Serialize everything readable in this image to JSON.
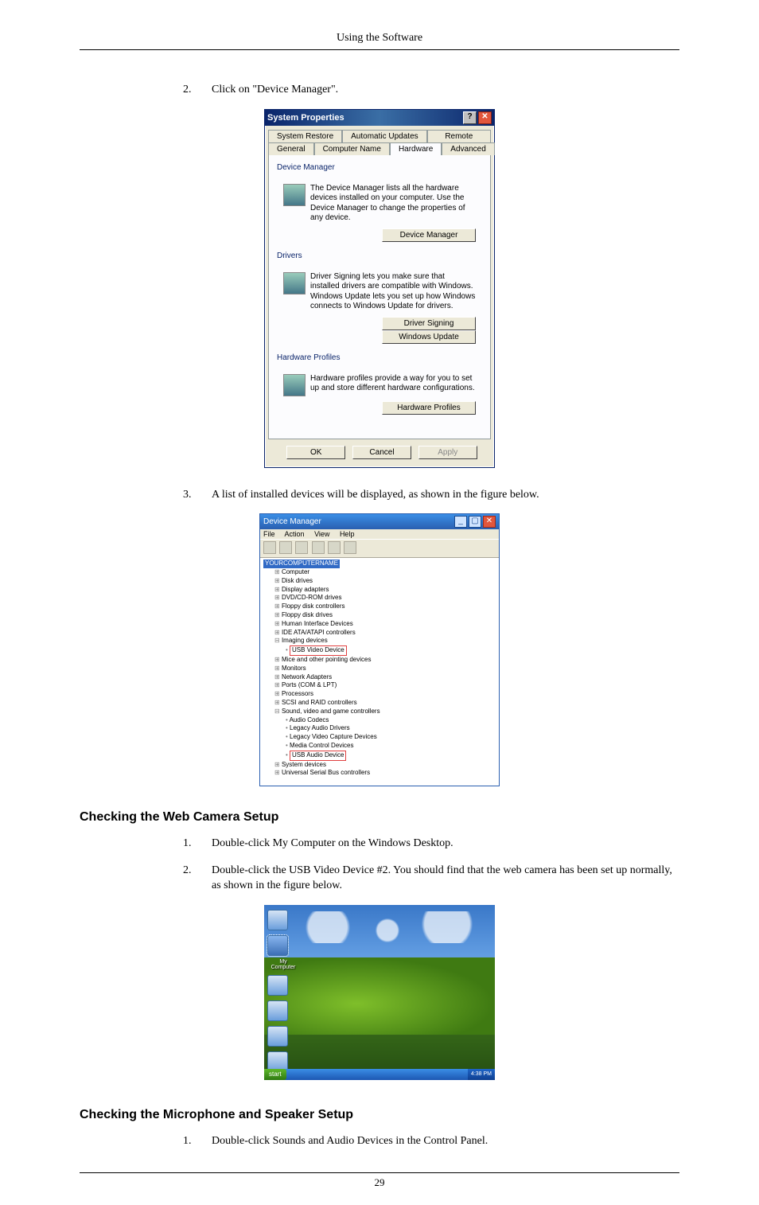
{
  "page": {
    "running_head": "Using the Software",
    "page_number": "29"
  },
  "intro_steps": [
    {
      "num": "2.",
      "text": "Click on \"Device Manager\"."
    },
    {
      "num": "3.",
      "text": "A list of installed devices will be displayed, as shown in the figure below."
    }
  ],
  "sections": {
    "web": {
      "title": "Checking the Web Camera Setup",
      "steps": [
        {
          "num": "1.",
          "text": "Double-click My Computer on the Windows Desktop."
        },
        {
          "num": "2.",
          "text": "Double-click the USB Video Device #2. You should find that the web camera has been set up normally, as shown in the figure below."
        }
      ]
    },
    "mic": {
      "title": "Checking the Microphone and Speaker Setup",
      "steps": [
        {
          "num": "1.",
          "text": "Double-click Sounds and Audio Devices in the Control Panel."
        }
      ]
    }
  },
  "sys_props": {
    "title": "System Properties",
    "tabs_row1": [
      "System Restore",
      "Automatic Updates",
      "Remote"
    ],
    "tabs_row2": [
      "General",
      "Computer Name",
      "Hardware",
      "Advanced"
    ],
    "selected_tab": "Hardware",
    "groups": {
      "devmgr": {
        "title": "Device Manager",
        "desc": "The Device Manager lists all the hardware devices installed on your computer. Use the Device Manager to change the properties of any device.",
        "button": "Device Manager"
      },
      "drivers": {
        "title": "Drivers",
        "desc": "Driver Signing lets you make sure that installed drivers are compatible with Windows. Windows Update lets you set up how Windows connects to Windows Update for drivers.",
        "button1": "Driver Signing",
        "button2": "Windows Update"
      },
      "hwprof": {
        "title": "Hardware Profiles",
        "desc": "Hardware profiles provide a way for you to set up and store different hardware configurations.",
        "button": "Hardware Profiles"
      }
    },
    "footer": {
      "ok": "OK",
      "cancel": "Cancel",
      "apply": "Apply"
    }
  },
  "devmgr": {
    "title": "Device Manager",
    "menus": [
      "File",
      "Action",
      "View",
      "Help"
    ],
    "root": "YOURCOMPUTERNAME",
    "nodes": [
      "Computer",
      "Disk drives",
      "Display adapters",
      "DVD/CD-ROM drives",
      "Floppy disk controllers",
      "Floppy disk drives",
      "Human Interface Devices",
      "IDE ATA/ATAPI controllers"
    ],
    "imaging": {
      "label": "Imaging devices",
      "child": "USB Video Device"
    },
    "nodes2": [
      "Mice and other pointing devices",
      "Monitors",
      "Network Adapters",
      "Ports (COM & LPT)",
      "Processors",
      "SCSI and RAID controllers"
    ],
    "svgc": {
      "label": "Sound, video and game controllers",
      "children": [
        "Audio Codecs",
        "Legacy Audio Drivers",
        "Legacy Video Capture Devices",
        "Media Control Devices"
      ],
      "highlight": "USB Audio Device"
    },
    "nodes3": [
      "System devices",
      "Universal Serial Bus controllers"
    ]
  },
  "desktop": {
    "my_computer": "My Computer",
    "start": "start",
    "time": "4:38 PM"
  }
}
